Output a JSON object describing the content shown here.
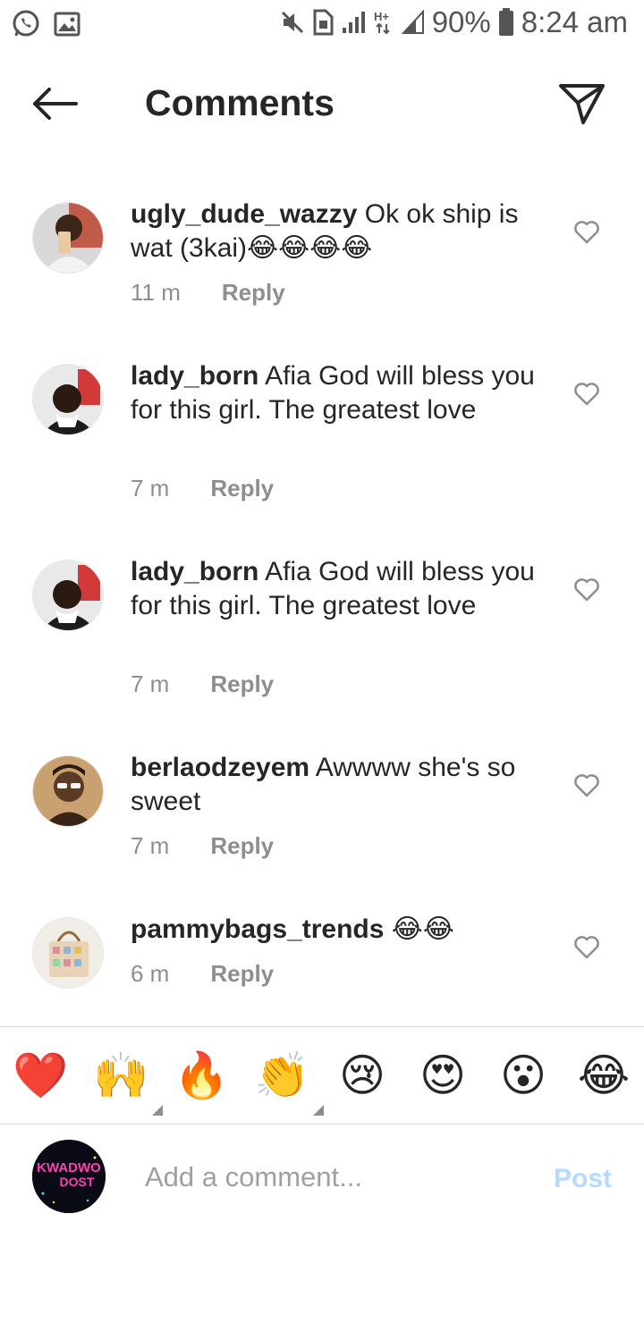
{
  "status_bar": {
    "battery": "90%",
    "time": "8:24 am",
    "network": "H+"
  },
  "header": {
    "title": "Comments",
    "back_icon": "arrow-left-icon",
    "share_icon": "send-icon"
  },
  "comments": [
    {
      "username": "ugly_dude_wazzy",
      "text": "Ok ok ship is wat (3kai)😂😂😂😂",
      "time": "11 m",
      "reply_label": "Reply"
    },
    {
      "username": "lady_born",
      "text": "Afia God will bless you for this girl. The greatest love",
      "time": "7 m",
      "reply_label": "Reply"
    },
    {
      "username": "lady_born",
      "text": "Afia God will bless you for this girl. The greatest love",
      "time": "7 m",
      "reply_label": "Reply"
    },
    {
      "username": "berlaodzeyem",
      "text": "Awwww she's so sweet",
      "time": "7 m",
      "reply_label": "Reply"
    },
    {
      "username": "pammybags_trends",
      "text": "😂😂",
      "time": "6 m",
      "reply_label": "Reply"
    }
  ],
  "emoji_bar": [
    "❤️",
    "🙌",
    "🔥",
    "👏",
    "😢",
    "😍",
    "😮",
    "😂"
  ],
  "composer": {
    "placeholder": "Add a comment...",
    "post_label": "Post",
    "avatar_text_line1": "KWADWO",
    "avatar_text_line2": "DOST"
  },
  "colors": {
    "text": "#262626",
    "meta": "#8e8e8e",
    "post_disabled": "#b3dbff",
    "divider": "#dbdbdb"
  }
}
